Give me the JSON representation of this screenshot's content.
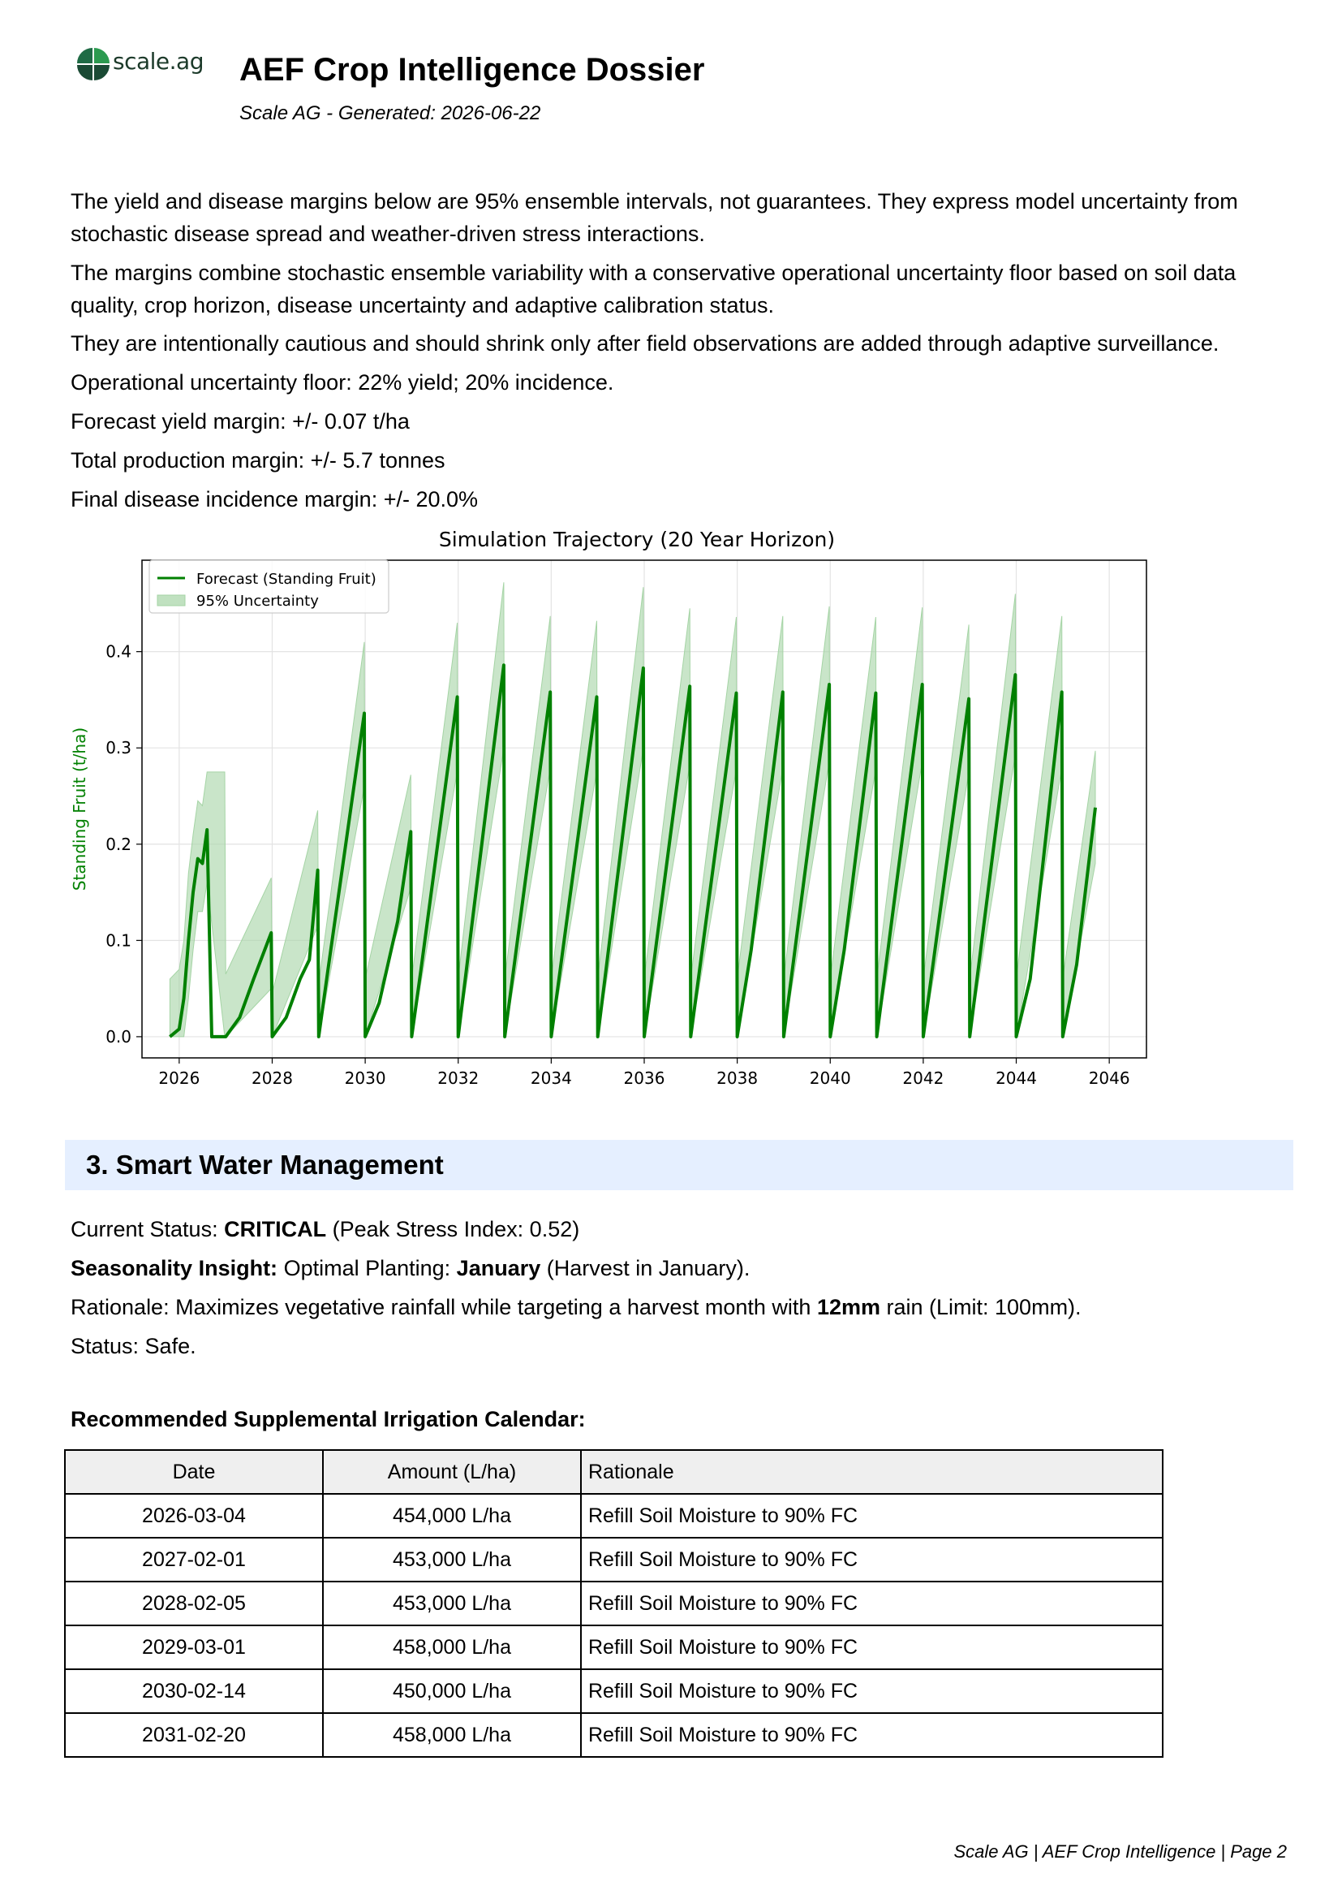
{
  "header": {
    "logo_text": "scale.ag",
    "title": "AEF Crop Intelligence Dossier",
    "subtitle": "Scale AG - Generated: 2026-06-22"
  },
  "intro": {
    "p1": "The yield and disease margins below are 95% ensemble intervals, not guarantees. They express model uncertainty from stochastic disease spread and weather-driven stress interactions.",
    "p2": "The margins combine stochastic ensemble variability with a conservative operational uncertainty floor based on soil data quality, crop horizon, disease uncertainty and adaptive calibration status.",
    "p3": "They are intentionally cautious and should shrink only after field observations are added through adaptive surveillance.",
    "p4": "Operational uncertainty floor: 22% yield; 20% incidence.",
    "p5": "Forecast yield margin: +/- 0.07 t/ha",
    "p6": "Total production margin: +/- 5.7 tonnes",
    "p7": "Final disease incidence margin: +/- 20.0%"
  },
  "colors": {
    "series": "#008000",
    "band": "#a5d4a5",
    "section_bg": "#e5efff"
  },
  "chart_data": {
    "type": "line",
    "title": "Simulation Trajectory (20 Year Horizon)",
    "xlabel": "",
    "ylabel": "Standing Fruit (t/ha)",
    "xlim": [
      2025.2,
      2046.8
    ],
    "ylim": [
      -0.022,
      0.495
    ],
    "xticks": [
      "2026",
      "2028",
      "2030",
      "2032",
      "2034",
      "2036",
      "2038",
      "2040",
      "2042",
      "2044",
      "2046"
    ],
    "yticks": [
      "0.0",
      "0.1",
      "0.2",
      "0.3",
      "0.4"
    ],
    "legend_position": "top-left",
    "grid": true,
    "series": [
      {
        "name": "Forecast (Standing Fruit)",
        "x": [
          2025.8,
          2026.0,
          2026.1,
          2026.2,
          2026.3,
          2026.4,
          2026.5,
          2026.6,
          2026.7,
          2026.8,
          2026.9,
          2026.98,
          2027.0,
          2027.3,
          2027.6,
          2027.98,
          2028.0,
          2028.3,
          2028.6,
          2028.8,
          2028.98,
          2029.0,
          2029.2,
          2029.98,
          2030.0,
          2030.3,
          2030.7,
          2030.98,
          2031.0,
          2031.2,
          2031.98,
          2032.0,
          2032.98,
          2033.0,
          2033.98,
          2034.0,
          2034.98,
          2035.0,
          2035.98,
          2036.0,
          2036.98,
          2037.0,
          2037.98,
          2038.0,
          2038.3,
          2038.98,
          2039.0,
          2039.98,
          2040.0,
          2040.3,
          2040.98,
          2041.0,
          2041.98,
          2042.0,
          2042.98,
          2043.0,
          2043.98,
          2044.0,
          2044.3,
          2044.98,
          2045.0,
          2045.3,
          2045.7
        ],
        "y": [
          0.0,
          0.008,
          0.04,
          0.1,
          0.15,
          0.185,
          0.18,
          0.215,
          0.0,
          0.0,
          0.0,
          0.0,
          0.0,
          0.02,
          0.06,
          0.108,
          0.0,
          0.02,
          0.06,
          0.08,
          0.173,
          0.0,
          0.07,
          0.336,
          0.0,
          0.035,
          0.12,
          0.213,
          0.0,
          0.07,
          0.353,
          0.0,
          0.386,
          0.0,
          0.358,
          0.0,
          0.353,
          0.0,
          0.383,
          0.0,
          0.364,
          0.0,
          0.357,
          0.0,
          0.09,
          0.358,
          0.0,
          0.366,
          0.0,
          0.09,
          0.357,
          0.0,
          0.366,
          0.0,
          0.351,
          0.0,
          0.376,
          0.0,
          0.06,
          0.358,
          0.0,
          0.075,
          0.238
        ]
      }
    ],
    "band": {
      "name": "95% Uncertainty",
      "x": [
        2025.8,
        2026.0,
        2026.1,
        2026.2,
        2026.3,
        2026.4,
        2026.5,
        2026.6,
        2026.98,
        2027.0,
        2027.98,
        2028.0,
        2028.98,
        2029.0,
        2029.98,
        2030.0,
        2030.98,
        2031.0,
        2031.98,
        2032.0,
        2032.98,
        2033.0,
        2033.98,
        2034.0,
        2034.98,
        2035.0,
        2035.98,
        2036.0,
        2036.98,
        2037.0,
        2037.98,
        2038.0,
        2038.98,
        2039.0,
        2039.98,
        2040.0,
        2040.98,
        2041.0,
        2041.98,
        2042.0,
        2042.98,
        2043.0,
        2043.98,
        2044.0,
        2044.98,
        2045.0,
        2045.7
      ],
      "upper": [
        0.06,
        0.07,
        0.1,
        0.17,
        0.21,
        0.245,
        0.24,
        0.275,
        0.275,
        0.065,
        0.165,
        0.045,
        0.235,
        0.055,
        0.41,
        0.06,
        0.272,
        0.06,
        0.43,
        0.06,
        0.472,
        0.06,
        0.437,
        0.06,
        0.432,
        0.06,
        0.467,
        0.06,
        0.445,
        0.06,
        0.436,
        0.06,
        0.437,
        0.06,
        0.447,
        0.06,
        0.436,
        0.06,
        0.446,
        0.06,
        0.428,
        0.06,
        0.46,
        0.06,
        0.437,
        0.06,
        0.297
      ],
      "lower": [
        0.0,
        0.0,
        0.0,
        0.04,
        0.09,
        0.13,
        0.13,
        0.16,
        0.0,
        0.0,
        0.05,
        0.0,
        0.115,
        0.0,
        0.26,
        0.0,
        0.155,
        0.0,
        0.276,
        0.0,
        0.3,
        0.0,
        0.279,
        0.0,
        0.276,
        0.0,
        0.3,
        0.0,
        0.283,
        0.0,
        0.278,
        0.0,
        0.279,
        0.0,
        0.286,
        0.0,
        0.278,
        0.0,
        0.286,
        0.0,
        0.274,
        0.0,
        0.293,
        0.0,
        0.279,
        0.0,
        0.18
      ]
    }
  },
  "water": {
    "section_title": "3. Smart Water Management",
    "status_prefix": "Current Status: ",
    "status_value": "CRITICAL",
    "status_suffix": " (Peak Stress Index: 0.52)",
    "season_label": "Seasonality Insight:",
    "season_text": " Optimal Planting: ",
    "season_month": "January",
    "season_suffix": " (Harvest in January).",
    "rationale_prefix": "Rationale: Maximizes vegetative rainfall while targeting a harvest month with ",
    "rationale_rain": "12mm",
    "rationale_suffix": " rain (Limit: 100mm).",
    "status_line": "Status: Safe."
  },
  "irrigation": {
    "heading": "Recommended Supplemental Irrigation Calendar:",
    "columns": [
      "Date",
      "Amount (L/ha)",
      "Rationale"
    ],
    "rows": [
      [
        "2026-03-04",
        "454,000 L/ha",
        "Refill Soil Moisture to 90% FC"
      ],
      [
        "2027-02-01",
        "453,000 L/ha",
        "Refill Soil Moisture to 90% FC"
      ],
      [
        "2028-02-05",
        "453,000 L/ha",
        "Refill Soil Moisture to 90% FC"
      ],
      [
        "2029-03-01",
        "458,000 L/ha",
        "Refill Soil Moisture to 90% FC"
      ],
      [
        "2030-02-14",
        "450,000 L/ha",
        "Refill Soil Moisture to 90% FC"
      ],
      [
        "2031-02-20",
        "458,000 L/ha",
        "Refill Soil Moisture to 90% FC"
      ]
    ]
  },
  "footer": {
    "text": "Scale AG | AEF Crop Intelligence | Page 2"
  }
}
